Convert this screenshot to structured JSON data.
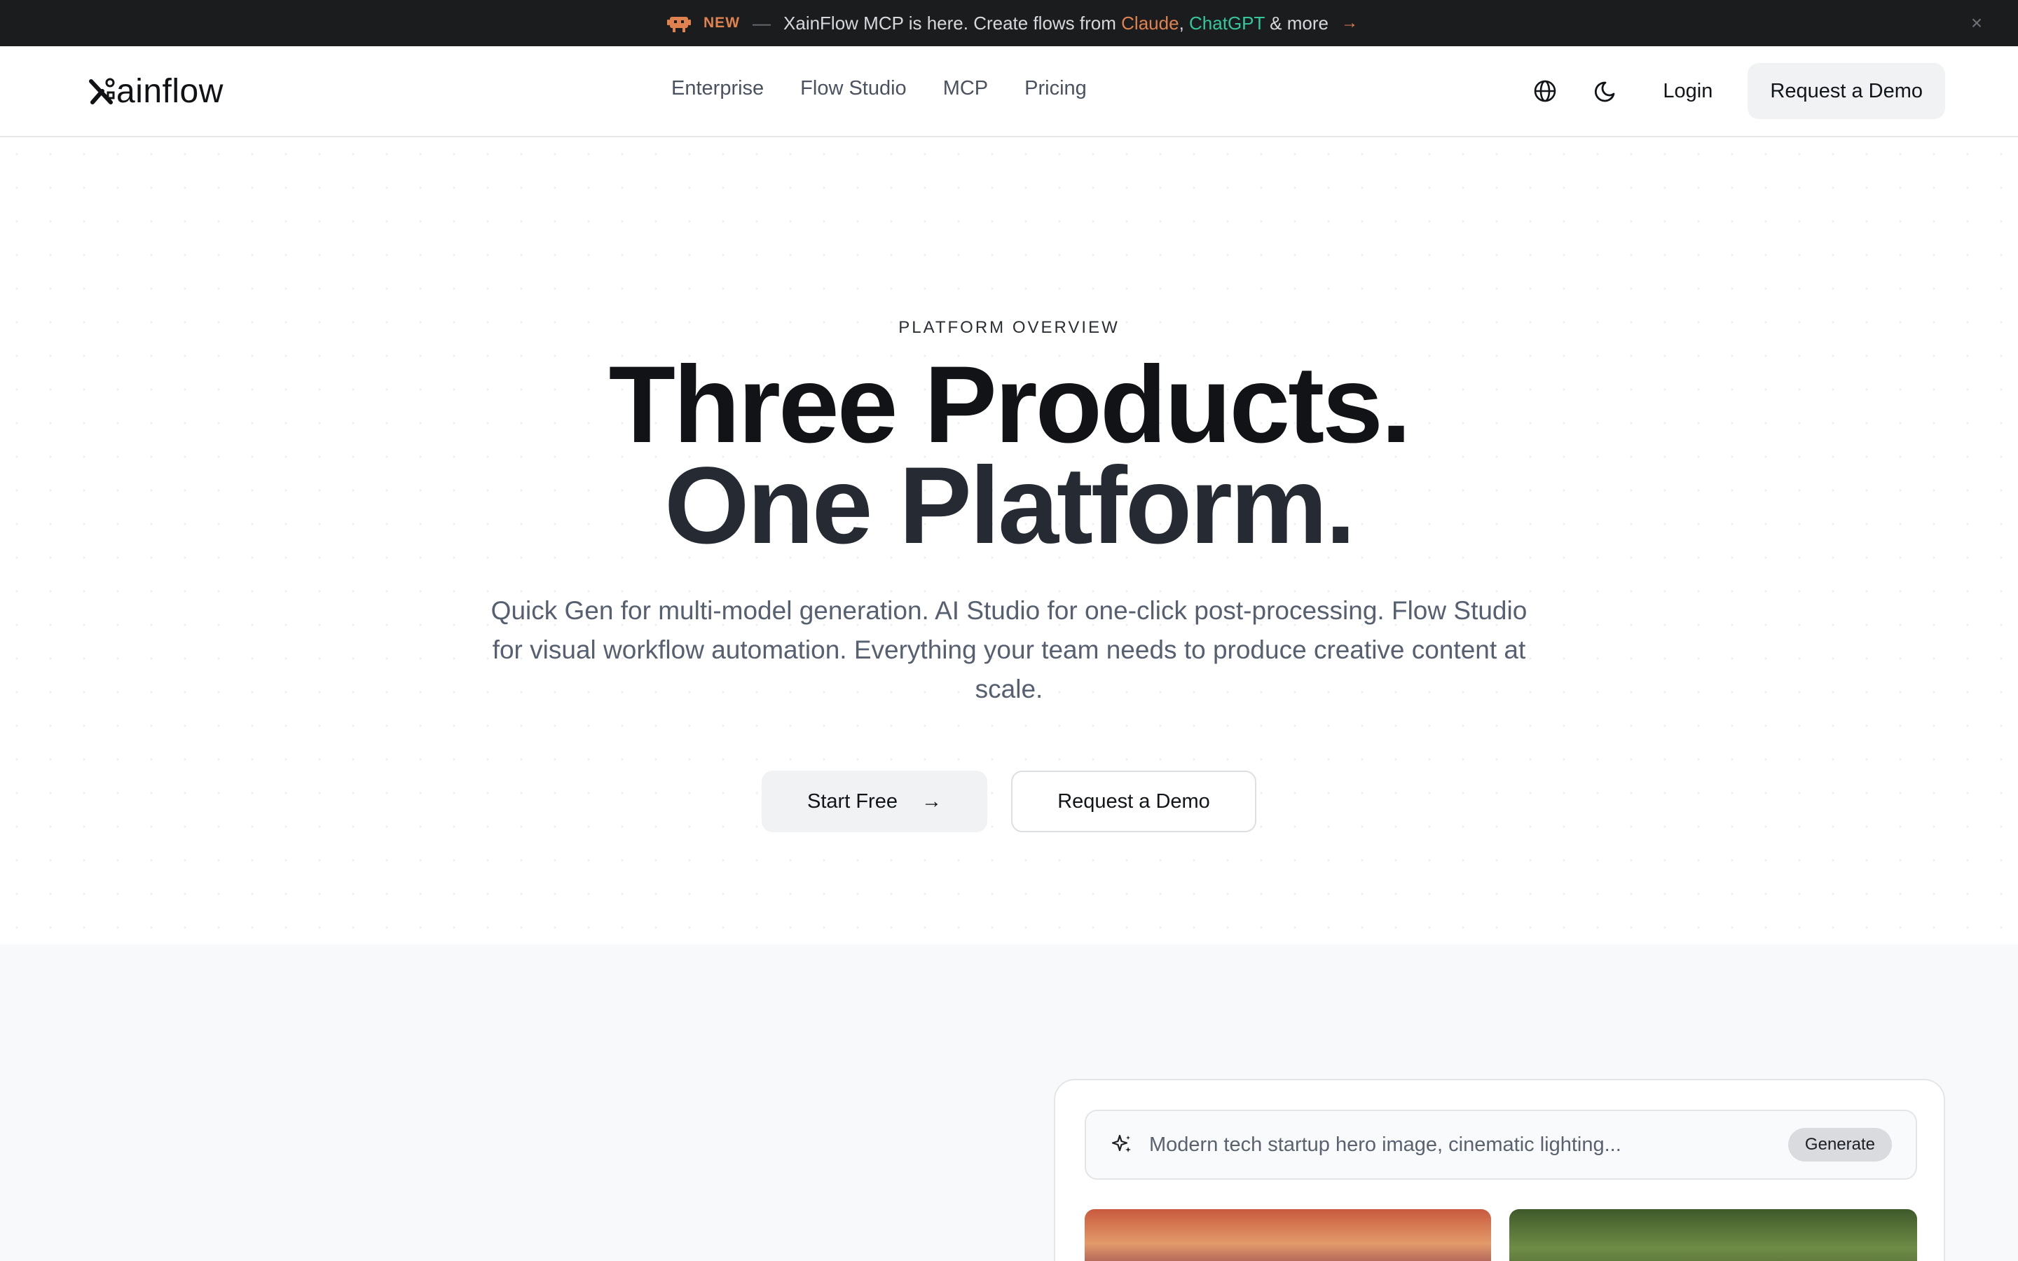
{
  "announcement": {
    "badge": "NEW",
    "dash": "—",
    "text_before": "XainFlow MCP is here. Create flows from",
    "claude": "Claude",
    "comma": ",",
    "chatgpt": "ChatGPT",
    "text_after": "& more",
    "arrow": "→",
    "close": "×"
  },
  "header": {
    "logo_text": "ainflow",
    "nav": [
      "Enterprise",
      "Flow Studio",
      "MCP",
      "Pricing"
    ],
    "login": "Login",
    "demo": "Request a Demo"
  },
  "hero": {
    "eyebrow": "PLATFORM OVERVIEW",
    "title_line1": "Three Products.",
    "title_line2": "One Platform.",
    "subtitle": "Quick Gen for multi-model generation. AI Studio for one-click post-processing. Flow Studio for visual workflow automation. Everything your team needs to produce creative content at scale.",
    "cta_primary": "Start Free",
    "cta_primary_arrow": "→",
    "cta_secondary": "Request a Demo"
  },
  "generator": {
    "placeholder": "Modern tech startup hero image, cinematic lighting...",
    "generate": "Generate"
  },
  "colors": {
    "accent_orange": "#e0824f",
    "accent_green": "#34c79c",
    "bar_bg": "#1b1c1e"
  }
}
